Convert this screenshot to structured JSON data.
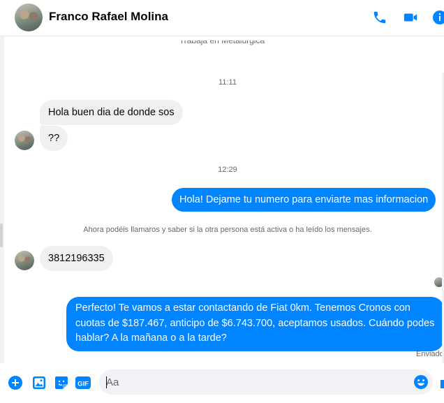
{
  "header": {
    "contact_name": "Franco Rafael Molina",
    "icons": [
      "phone-icon",
      "video-icon",
      "info-icon"
    ]
  },
  "thread": {
    "intro_line": "Trabaja en Metalúrgica",
    "time_1": "11:11",
    "incoming_1": "Hola buen dia de donde sos",
    "incoming_2": "??",
    "time_2": "12:29",
    "outgoing_1": "Hola! Dejame tu numero para enviarte mas informacion",
    "notice": "Ahora podéis llamaros y saber si la otra persona está activa o ha leído los mensajes.",
    "incoming_3": "3812196335",
    "outgoing_2": "Perfecto! Te vamos a estar contactando de Fiat 0km. Tenemos Cronos con cuotas de $187.467, anticipo de $6.743.700, aceptamos usados. Cuándo podes hablar? A la mañana o a la tarde?",
    "status": "Enviado"
  },
  "composer": {
    "placeholder": "Aa",
    "icons": [
      "plus-icon",
      "image-icon",
      "sticker-icon",
      "gif-icon",
      "emoji-icon"
    ],
    "gif_label": "GIF"
  },
  "colors": {
    "accent": "#0084ff",
    "incoming_bubble": "#f0f0f0",
    "muted_text": "#65676b"
  }
}
